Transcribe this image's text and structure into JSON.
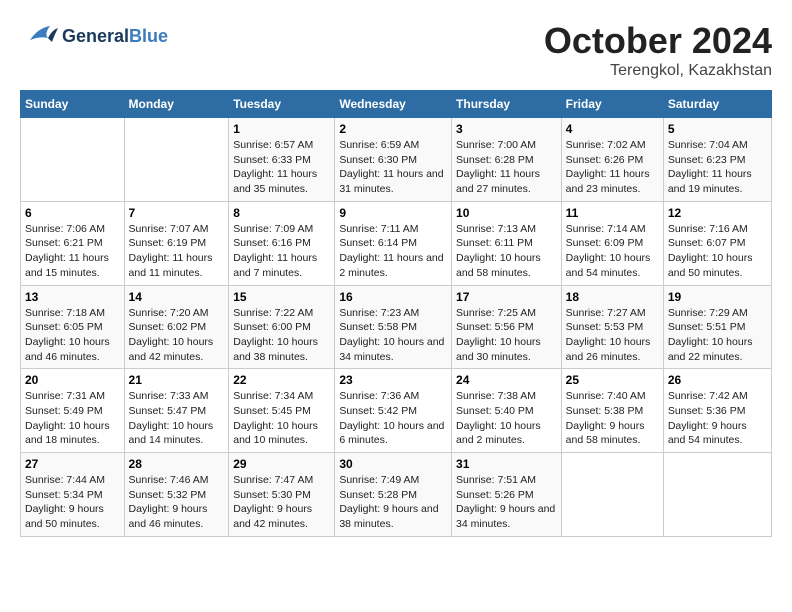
{
  "logo": {
    "part1": "General",
    "part2": "Blue"
  },
  "title": "October 2024",
  "location": "Terengkol, Kazakhstan",
  "days_of_week": [
    "Sunday",
    "Monday",
    "Tuesday",
    "Wednesday",
    "Thursday",
    "Friday",
    "Saturday"
  ],
  "weeks": [
    [
      {
        "day": "",
        "sunrise": "",
        "sunset": "",
        "daylight": ""
      },
      {
        "day": "",
        "sunrise": "",
        "sunset": "",
        "daylight": ""
      },
      {
        "day": "1",
        "sunrise": "Sunrise: 6:57 AM",
        "sunset": "Sunset: 6:33 PM",
        "daylight": "Daylight: 11 hours and 35 minutes."
      },
      {
        "day": "2",
        "sunrise": "Sunrise: 6:59 AM",
        "sunset": "Sunset: 6:30 PM",
        "daylight": "Daylight: 11 hours and 31 minutes."
      },
      {
        "day": "3",
        "sunrise": "Sunrise: 7:00 AM",
        "sunset": "Sunset: 6:28 PM",
        "daylight": "Daylight: 11 hours and 27 minutes."
      },
      {
        "day": "4",
        "sunrise": "Sunrise: 7:02 AM",
        "sunset": "Sunset: 6:26 PM",
        "daylight": "Daylight: 11 hours and 23 minutes."
      },
      {
        "day": "5",
        "sunrise": "Sunrise: 7:04 AM",
        "sunset": "Sunset: 6:23 PM",
        "daylight": "Daylight: 11 hours and 19 minutes."
      }
    ],
    [
      {
        "day": "6",
        "sunrise": "Sunrise: 7:06 AM",
        "sunset": "Sunset: 6:21 PM",
        "daylight": "Daylight: 11 hours and 15 minutes."
      },
      {
        "day": "7",
        "sunrise": "Sunrise: 7:07 AM",
        "sunset": "Sunset: 6:19 PM",
        "daylight": "Daylight: 11 hours and 11 minutes."
      },
      {
        "day": "8",
        "sunrise": "Sunrise: 7:09 AM",
        "sunset": "Sunset: 6:16 PM",
        "daylight": "Daylight: 11 hours and 7 minutes."
      },
      {
        "day": "9",
        "sunrise": "Sunrise: 7:11 AM",
        "sunset": "Sunset: 6:14 PM",
        "daylight": "Daylight: 11 hours and 2 minutes."
      },
      {
        "day": "10",
        "sunrise": "Sunrise: 7:13 AM",
        "sunset": "Sunset: 6:11 PM",
        "daylight": "Daylight: 10 hours and 58 minutes."
      },
      {
        "day": "11",
        "sunrise": "Sunrise: 7:14 AM",
        "sunset": "Sunset: 6:09 PM",
        "daylight": "Daylight: 10 hours and 54 minutes."
      },
      {
        "day": "12",
        "sunrise": "Sunrise: 7:16 AM",
        "sunset": "Sunset: 6:07 PM",
        "daylight": "Daylight: 10 hours and 50 minutes."
      }
    ],
    [
      {
        "day": "13",
        "sunrise": "Sunrise: 7:18 AM",
        "sunset": "Sunset: 6:05 PM",
        "daylight": "Daylight: 10 hours and 46 minutes."
      },
      {
        "day": "14",
        "sunrise": "Sunrise: 7:20 AM",
        "sunset": "Sunset: 6:02 PM",
        "daylight": "Daylight: 10 hours and 42 minutes."
      },
      {
        "day": "15",
        "sunrise": "Sunrise: 7:22 AM",
        "sunset": "Sunset: 6:00 PM",
        "daylight": "Daylight: 10 hours and 38 minutes."
      },
      {
        "day": "16",
        "sunrise": "Sunrise: 7:23 AM",
        "sunset": "Sunset: 5:58 PM",
        "daylight": "Daylight: 10 hours and 34 minutes."
      },
      {
        "day": "17",
        "sunrise": "Sunrise: 7:25 AM",
        "sunset": "Sunset: 5:56 PM",
        "daylight": "Daylight: 10 hours and 30 minutes."
      },
      {
        "day": "18",
        "sunrise": "Sunrise: 7:27 AM",
        "sunset": "Sunset: 5:53 PM",
        "daylight": "Daylight: 10 hours and 26 minutes."
      },
      {
        "day": "19",
        "sunrise": "Sunrise: 7:29 AM",
        "sunset": "Sunset: 5:51 PM",
        "daylight": "Daylight: 10 hours and 22 minutes."
      }
    ],
    [
      {
        "day": "20",
        "sunrise": "Sunrise: 7:31 AM",
        "sunset": "Sunset: 5:49 PM",
        "daylight": "Daylight: 10 hours and 18 minutes."
      },
      {
        "day": "21",
        "sunrise": "Sunrise: 7:33 AM",
        "sunset": "Sunset: 5:47 PM",
        "daylight": "Daylight: 10 hours and 14 minutes."
      },
      {
        "day": "22",
        "sunrise": "Sunrise: 7:34 AM",
        "sunset": "Sunset: 5:45 PM",
        "daylight": "Daylight: 10 hours and 10 minutes."
      },
      {
        "day": "23",
        "sunrise": "Sunrise: 7:36 AM",
        "sunset": "Sunset: 5:42 PM",
        "daylight": "Daylight: 10 hours and 6 minutes."
      },
      {
        "day": "24",
        "sunrise": "Sunrise: 7:38 AM",
        "sunset": "Sunset: 5:40 PM",
        "daylight": "Daylight: 10 hours and 2 minutes."
      },
      {
        "day": "25",
        "sunrise": "Sunrise: 7:40 AM",
        "sunset": "Sunset: 5:38 PM",
        "daylight": "Daylight: 9 hours and 58 minutes."
      },
      {
        "day": "26",
        "sunrise": "Sunrise: 7:42 AM",
        "sunset": "Sunset: 5:36 PM",
        "daylight": "Daylight: 9 hours and 54 minutes."
      }
    ],
    [
      {
        "day": "27",
        "sunrise": "Sunrise: 7:44 AM",
        "sunset": "Sunset: 5:34 PM",
        "daylight": "Daylight: 9 hours and 50 minutes."
      },
      {
        "day": "28",
        "sunrise": "Sunrise: 7:46 AM",
        "sunset": "Sunset: 5:32 PM",
        "daylight": "Daylight: 9 hours and 46 minutes."
      },
      {
        "day": "29",
        "sunrise": "Sunrise: 7:47 AM",
        "sunset": "Sunset: 5:30 PM",
        "daylight": "Daylight: 9 hours and 42 minutes."
      },
      {
        "day": "30",
        "sunrise": "Sunrise: 7:49 AM",
        "sunset": "Sunset: 5:28 PM",
        "daylight": "Daylight: 9 hours and 38 minutes."
      },
      {
        "day": "31",
        "sunrise": "Sunrise: 7:51 AM",
        "sunset": "Sunset: 5:26 PM",
        "daylight": "Daylight: 9 hours and 34 minutes."
      },
      {
        "day": "",
        "sunrise": "",
        "sunset": "",
        "daylight": ""
      },
      {
        "day": "",
        "sunrise": "",
        "sunset": "",
        "daylight": ""
      }
    ]
  ]
}
